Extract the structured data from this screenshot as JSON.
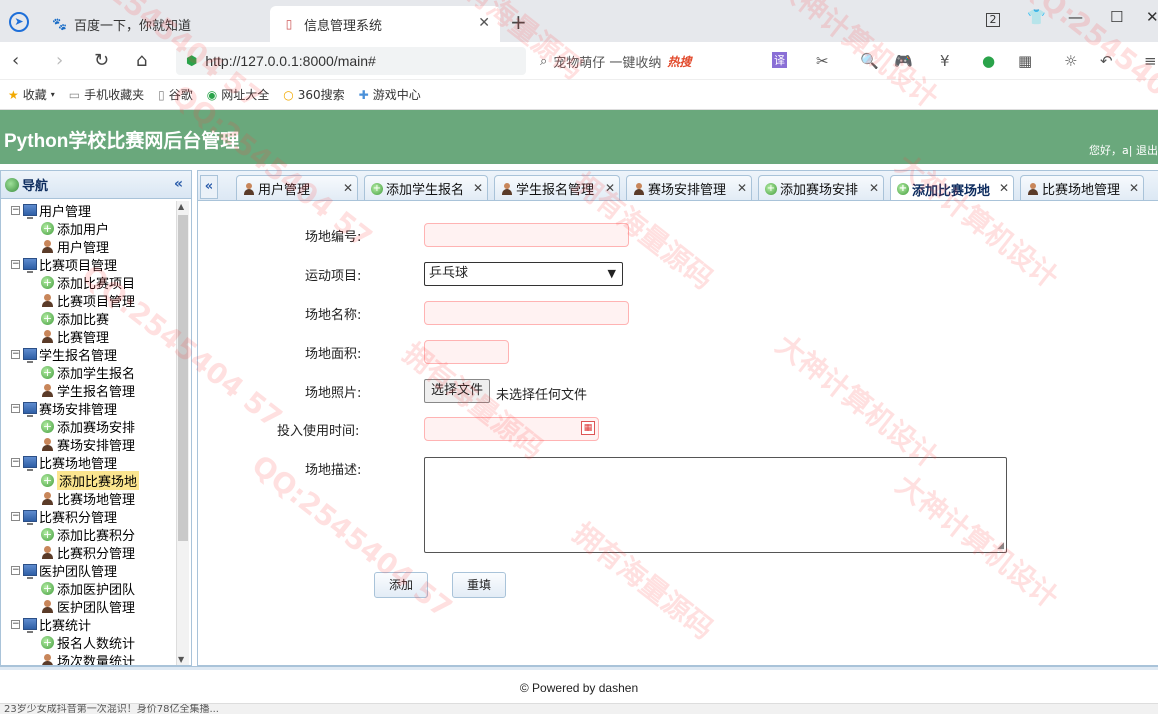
{
  "browser": {
    "tabs": [
      {
        "title": "百度一下，你就知道",
        "icon": "baidu-paw-icon"
      },
      {
        "title": "信息管理系统",
        "icon": "document-icon"
      }
    ],
    "url": "http://127.0.0.1:8000/main#",
    "search_placeholder": "宠物萌仔 一键收纳",
    "search_hot": "热搜",
    "tab_count": "2",
    "bookmarks": [
      "收藏",
      "手机收藏夹",
      "谷歌",
      "网址大全",
      "360搜索",
      "游戏中心"
    ],
    "translate_label": "译",
    "status_text": "23岁少女成抖音第一次混识！身价78亿全集播..."
  },
  "app": {
    "title": "Python学校比赛网后台管理",
    "greeting": "您好，a| 退出"
  },
  "sidebar": {
    "title": "导航",
    "groups": [
      {
        "label": "用户管理",
        "items": [
          {
            "label": "添加用户",
            "icon": "add-icon"
          },
          {
            "label": "用户管理",
            "icon": "user-icon"
          }
        ]
      },
      {
        "label": "比赛项目管理",
        "items": [
          {
            "label": "添加比赛项目",
            "icon": "add-icon"
          },
          {
            "label": "比赛项目管理",
            "icon": "user-icon"
          },
          {
            "label": "添加比赛",
            "icon": "add-icon"
          },
          {
            "label": "比赛管理",
            "icon": "user-icon"
          }
        ]
      },
      {
        "label": "学生报名管理",
        "items": [
          {
            "label": "添加学生报名",
            "icon": "add-icon"
          },
          {
            "label": "学生报名管理",
            "icon": "user-icon"
          }
        ]
      },
      {
        "label": "赛场安排管理",
        "items": [
          {
            "label": "添加赛场安排",
            "icon": "add-icon"
          },
          {
            "label": "赛场安排管理",
            "icon": "user-icon"
          }
        ]
      },
      {
        "label": "比赛场地管理",
        "items": [
          {
            "label": "添加比赛场地",
            "icon": "add-icon",
            "selected": true
          },
          {
            "label": "比赛场地管理",
            "icon": "user-icon"
          }
        ]
      },
      {
        "label": "比赛积分管理",
        "items": [
          {
            "label": "添加比赛积分",
            "icon": "add-icon"
          },
          {
            "label": "比赛积分管理",
            "icon": "user-icon"
          }
        ]
      },
      {
        "label": "医护团队管理",
        "items": [
          {
            "label": "添加医护团队",
            "icon": "add-icon"
          },
          {
            "label": "医护团队管理",
            "icon": "user-icon"
          }
        ]
      },
      {
        "label": "比赛统计",
        "items": [
          {
            "label": "报名人数统计",
            "icon": "add-icon"
          },
          {
            "label": "场次数量统计",
            "icon": "user-icon"
          }
        ]
      }
    ]
  },
  "content_tabs": [
    {
      "label": "用户管理",
      "icon": "user-icon"
    },
    {
      "label": "添加学生报名",
      "icon": "add-icon"
    },
    {
      "label": "学生报名管理",
      "icon": "user-icon"
    },
    {
      "label": "赛场安排管理",
      "icon": "user-icon"
    },
    {
      "label": "添加赛场安排",
      "icon": "add-icon"
    },
    {
      "label": "添加比赛场地",
      "icon": "add-icon",
      "active": true
    },
    {
      "label": "比赛场地管理",
      "icon": "user-icon"
    }
  ],
  "form": {
    "venue_no_label": "场地编号:",
    "venue_no_value": "",
    "sport_label": "运动项目:",
    "sport_value": "乒乓球",
    "venue_name_label": "场地名称:",
    "venue_name_value": "",
    "area_label": "场地面积:",
    "area_value": "",
    "photo_label": "场地照片:",
    "photo_button": "选择文件",
    "photo_status": "未选择任何文件",
    "start_date_label": "投入使用时间:",
    "start_date_value": "",
    "desc_label": "场地描述:",
    "desc_value": "",
    "submit_label": "添加",
    "reset_label": "重填"
  },
  "footer": "© Powered by dashen",
  "watermarks": [
    "QQ:2545404 57",
    "拥有海量源码",
    "大神计算机设计"
  ]
}
